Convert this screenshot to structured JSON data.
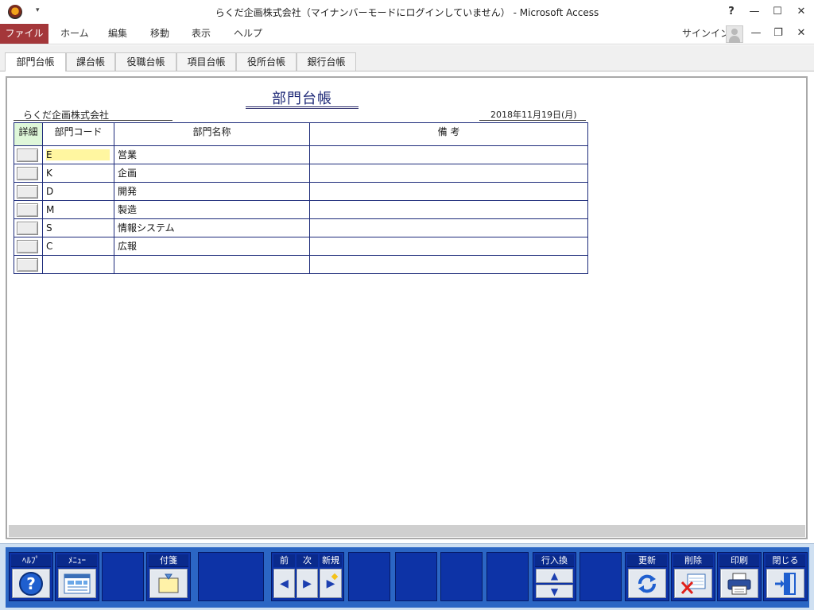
{
  "window": {
    "title": "らくだ企画株式会社（マイナンバーモードにログインしていません） - Microsoft Access",
    "qat_glyph": "▾",
    "help_glyph": "?",
    "minimize_glyph": "—",
    "maximize_glyph": "☐",
    "close_glyph": "✕"
  },
  "ribbon": {
    "file_tab": "ファイル",
    "tabs": [
      "ホーム",
      "編集",
      "移動",
      "表示",
      "ヘルプ"
    ],
    "sign_in": "サインイン",
    "doc_minimize_glyph": "—",
    "doc_restore_glyph": "❐",
    "doc_close_glyph": "✕"
  },
  "document_tabs": [
    "部門台帳",
    "課台帳",
    "役職台帳",
    "項目台帳",
    "役所台帳",
    "銀行台帳"
  ],
  "form": {
    "title": "部門台帳",
    "company": "らくだ企画株式会社",
    "date": "2018年11月19日(月)",
    "columns": [
      "詳細",
      "部門コード",
      "部門名称",
      "備 考"
    ],
    "rows": [
      {
        "code": "E",
        "name": "営業",
        "note": ""
      },
      {
        "code": "K",
        "name": "企画",
        "note": ""
      },
      {
        "code": "D",
        "name": "開発",
        "note": ""
      },
      {
        "code": "M",
        "name": "製造",
        "note": ""
      },
      {
        "code": "S",
        "name": "情報システム",
        "note": ""
      },
      {
        "code": "C",
        "name": "広報",
        "note": ""
      },
      {
        "code": "",
        "name": "",
        "note": ""
      }
    ]
  },
  "command_bar": {
    "help": "ﾍﾙﾌﾟ",
    "menu": "ﾒﾆｭｰ",
    "sticky": "付箋",
    "prev": "前",
    "next": "次",
    "new": "新規",
    "row_swap": "行入換",
    "update": "更新",
    "delete": "削除",
    "print": "印刷",
    "close": "閉じる",
    "help_glyph": "?",
    "prev_glyph": "◀",
    "next_glyph": "▶",
    "new_glyph": "▶",
    "up_glyph": "▲",
    "down_glyph": "▼"
  },
  "icons": {
    "app": "access-app-icon",
    "help": "question-circle-icon",
    "menu": "menu-window-icon",
    "sticky": "sticky-note-icon",
    "update": "refresh-arrows-icon",
    "delete": "delete-x-icon",
    "print": "printer-icon",
    "close": "exit-door-icon"
  },
  "colors": {
    "file_tab": "#a4373a",
    "command_bar": "#2b66c4",
    "command_button": "#0d33a6",
    "grid_border": "#1d2b7a",
    "active_cell": "#fff6a0",
    "title_text": "#1f2a78"
  }
}
